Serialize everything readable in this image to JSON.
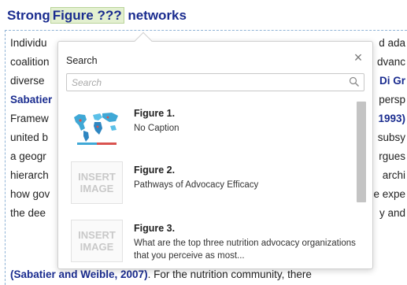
{
  "heading": {
    "prefix": "Strong",
    "highlight": "Figure ???",
    "suffix": " networks"
  },
  "document": {
    "lines_left": [
      "Individu",
      "coalition",
      "diverse",
      "Sabatier",
      "Framew",
      "united b",
      "a geogr",
      "hierarch",
      "how gov",
      "the dee"
    ],
    "lines_right": [
      "d ada",
      "dvanc",
      "Di Gr",
      "persp",
      "1993)",
      "subsy",
      "rgues",
      "archi",
      "e expe",
      "y and"
    ],
    "last_line": {
      "cite": "(Sabatier and Weible, 2007)",
      "rest": ". For the nutrition community, there"
    }
  },
  "popup": {
    "title": "Search",
    "close_symbol": "×",
    "search_placeholder": "Search",
    "search_value": "",
    "results": [
      {
        "title": "Figure 1.",
        "caption": "No Caption",
        "thumb_icon": "world-map-icon",
        "thumb_text": ""
      },
      {
        "title": "Figure 2.",
        "caption": "Pathways of Advocacy Efficacy",
        "thumb_icon": "insert-image-placeholder",
        "thumb_text": "INSERT IMAGE"
      },
      {
        "title": "Figure 3.",
        "caption": "What are the top three nutrition advocacy organizations that you perceive as most...",
        "thumb_icon": "insert-image-placeholder",
        "thumb_text": "INSERT IMAGE"
      }
    ]
  },
  "colors": {
    "heading": "#1a2c8f",
    "highlight_bg": "#e3f0d0",
    "doc_border": "#8fb3d6",
    "scrollbar": "#c4c4c4",
    "placeholder_text": "#c9c9c9"
  }
}
